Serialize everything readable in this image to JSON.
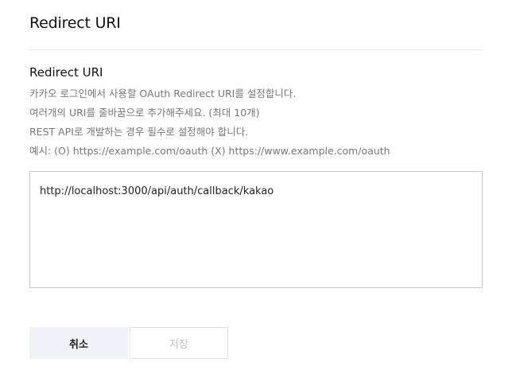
{
  "dialog": {
    "title": "Redirect URI"
  },
  "section": {
    "title": "Redirect URI",
    "description": [
      "카카오 로그인에서 사용할 OAuth Redirect URI를 설정합니다.",
      "여러개의 URI를 줄바꿈으로 추가해주세요. (최대 10개)",
      "REST API로 개발하는 경우 필수로 설정해야 합니다.",
      "예시: (O) https://example.com/oauth (X) https://www.example.com/oauth"
    ]
  },
  "uri_input": {
    "value": "http://localhost:3000/api/auth/callback/kakao",
    "placeholder": ""
  },
  "buttons": {
    "cancel_label": "취소",
    "save_label": "저장",
    "save_disabled": true
  }
}
